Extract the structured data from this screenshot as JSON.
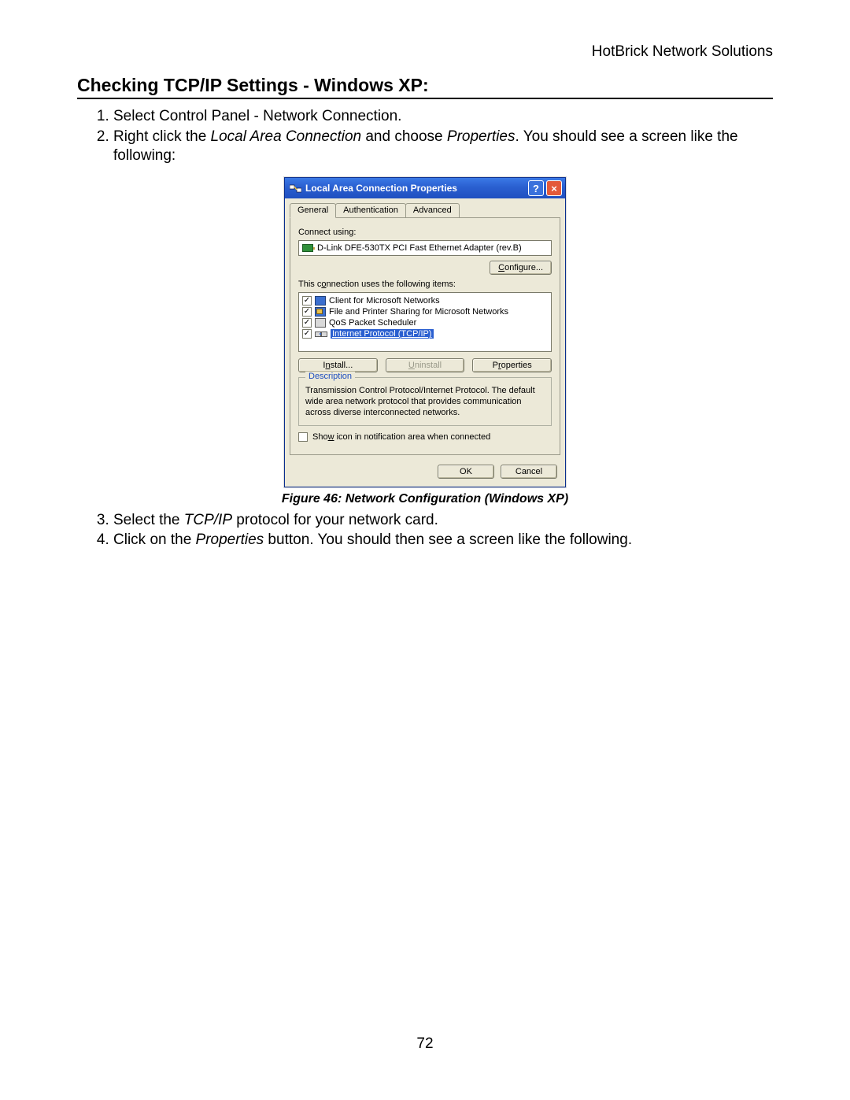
{
  "header": {
    "company": "HotBrick Network Solutions"
  },
  "section": {
    "title": "Checking TCP/IP Settings - Windows XP:"
  },
  "steps_a": [
    {
      "n": "1.",
      "prefix": "Select Control Panel - Network Connection.",
      "italic1": "",
      "mid": "",
      "italic2": "",
      "suffix": ""
    },
    {
      "n": "2.",
      "prefix": "Right click the ",
      "italic1": "Local Area Connection",
      "mid": " and choose ",
      "italic2": "Properties",
      "suffix": ". You should see a screen like the following:"
    }
  ],
  "figure": {
    "caption": "Figure 46: Network Configuration (Windows XP)"
  },
  "steps_b": [
    {
      "n": "3.",
      "prefix": "Select the ",
      "italic1": "TCP/IP",
      "mid": " protocol for your network card.",
      "italic2": "",
      "suffix": ""
    },
    {
      "n": "4.",
      "prefix": "Click on the ",
      "italic1": "Properties",
      "mid": " button. You should then see a screen like the following.",
      "italic2": "",
      "suffix": ""
    }
  ],
  "page_number": "72",
  "dialog": {
    "title": "Local Area Connection Properties",
    "help": "?",
    "close": "×",
    "tabs": {
      "general": "General",
      "auth": "Authentication",
      "advanced": "Advanced"
    },
    "connect_using_label": "Connect using:",
    "adapter": "D-Link DFE-530TX PCI Fast Ethernet Adapter (rev.B)",
    "configure_u": "C",
    "configure_rest": "onfigure...",
    "items_label_pre": "This c",
    "items_label_u": "o",
    "items_label_post": "nnection uses the following items:",
    "items": [
      {
        "checked": true,
        "icon": "client",
        "text": "Client for Microsoft Networks",
        "selected": false
      },
      {
        "checked": true,
        "icon": "file",
        "text": "File and Printer Sharing for Microsoft Networks",
        "selected": false
      },
      {
        "checked": true,
        "icon": "qos",
        "text": "QoS Packet Scheduler",
        "selected": false
      },
      {
        "checked": true,
        "icon": "tcpip",
        "text": "Internet Protocol (TCP/IP)",
        "selected": true
      }
    ],
    "install_u": "n",
    "install_pre": "I",
    "install_post": "stall...",
    "uninstall_u": "U",
    "uninstall_post": "ninstall",
    "properties_u": "r",
    "properties_pre": "P",
    "properties_post": "operties",
    "description_legend": "Description",
    "description_text": "Transmission Control Protocol/Internet Protocol. The default wide area network protocol that provides communication across diverse interconnected networks.",
    "show_icon_pre": "Sho",
    "show_icon_u": "w",
    "show_icon_post": " icon in notification area when connected",
    "ok": "OK",
    "cancel": "Cancel"
  }
}
